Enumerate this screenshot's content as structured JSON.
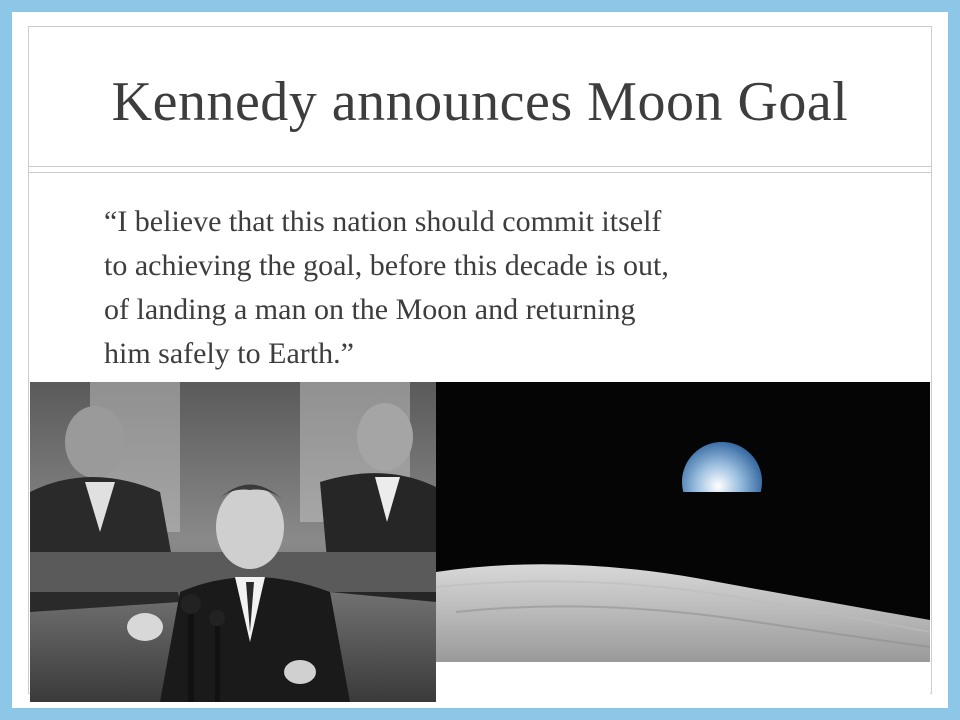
{
  "slide": {
    "title": "Kennedy announces Moon Goal",
    "quote_lines": [
      "“I believe that this nation should commit itself",
      "to achieving the goal, before this decade is out,",
      "of landing a man on the Moon and returning",
      "him safely to Earth.”"
    ]
  },
  "images": {
    "left": "kennedy-speech-photo",
    "right": "earthrise-photo"
  },
  "colors": {
    "background": "#8dc7e8",
    "slide": "#ffffff",
    "text": "#3d3d3d",
    "rule": "#c9cdd3"
  }
}
